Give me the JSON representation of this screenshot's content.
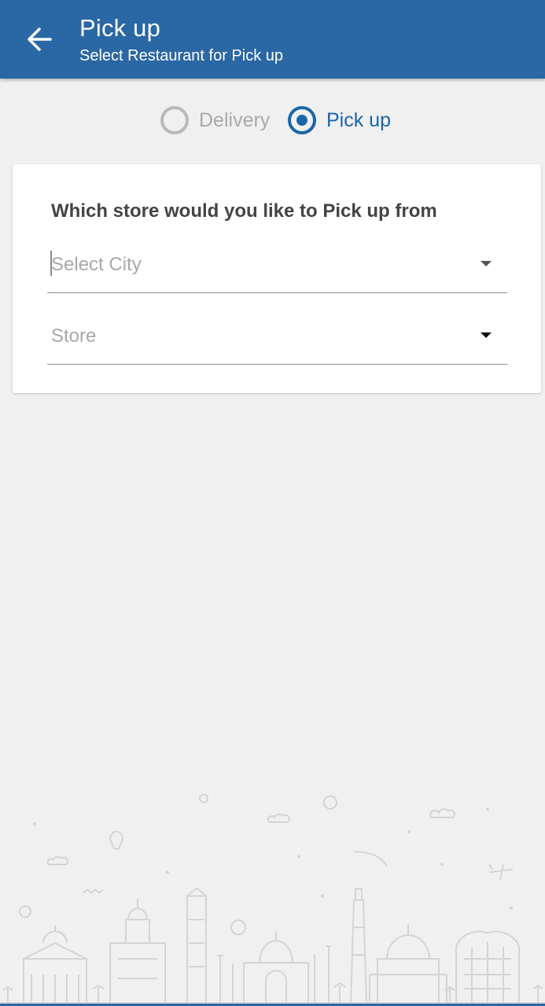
{
  "header": {
    "title": "Pick up",
    "subtitle": "Select Restaurant for Pick up",
    "back_icon": "arrow-left-icon",
    "background_color": "#2a67a5"
  },
  "order_type": {
    "options": [
      {
        "label": "Delivery",
        "selected": false
      },
      {
        "label": "Pick up",
        "selected": true
      }
    ],
    "accent_color": "#1a66a8"
  },
  "store_card": {
    "heading": "Which store would you like to Pick up from",
    "city_dropdown": {
      "placeholder": "Select City",
      "value": ""
    },
    "store_dropdown": {
      "placeholder": "Store",
      "value": ""
    }
  },
  "illustration": "city-skyline-illustration"
}
